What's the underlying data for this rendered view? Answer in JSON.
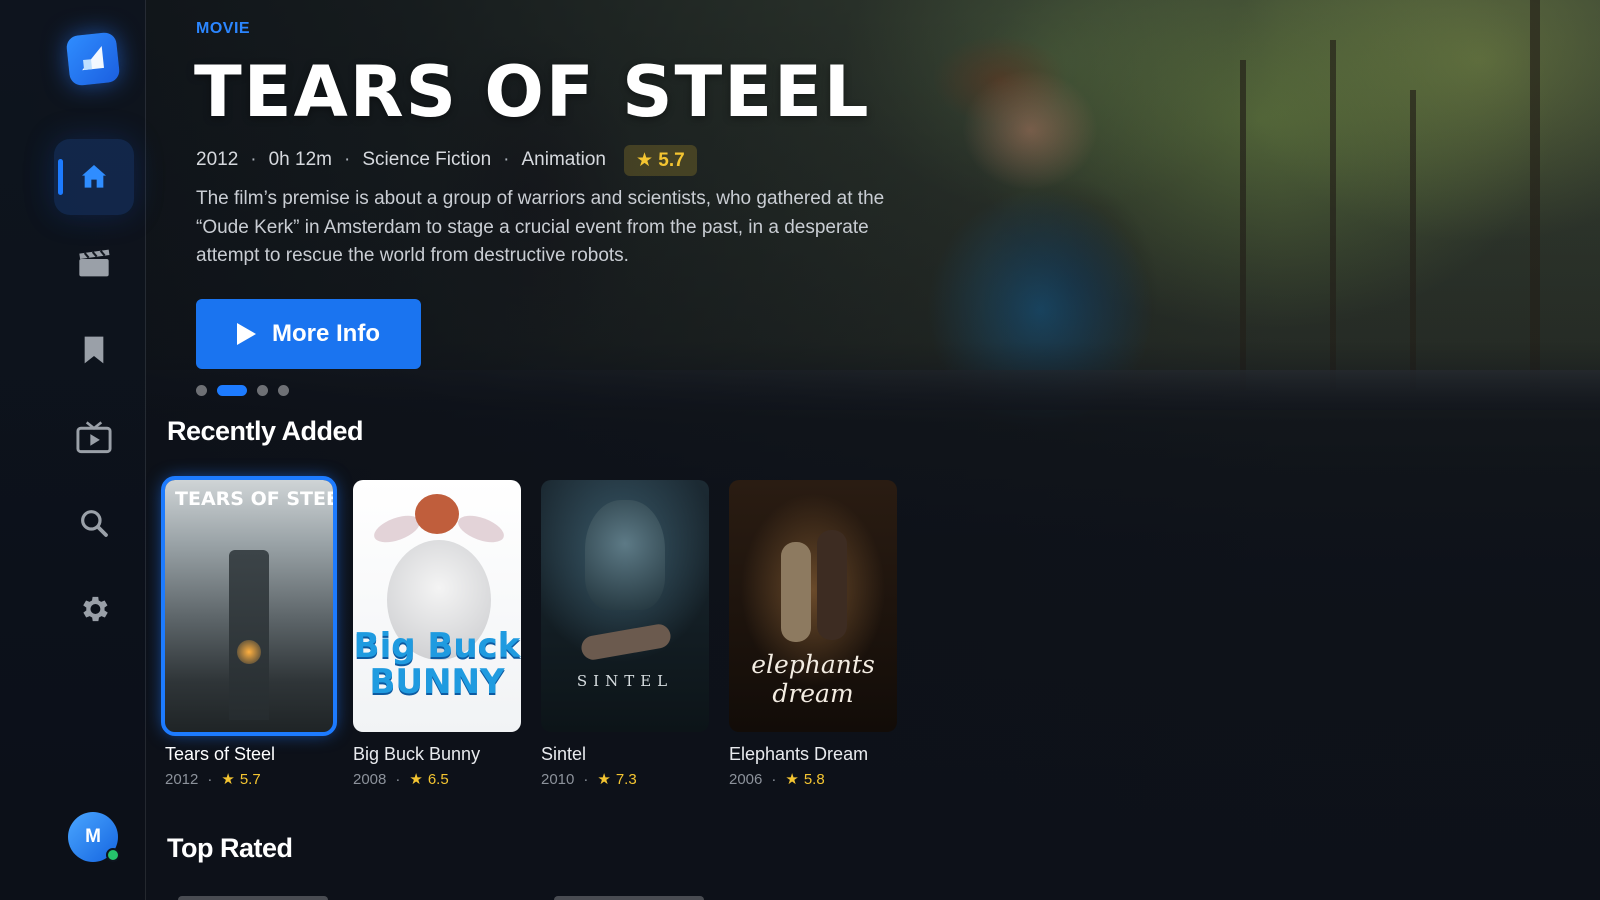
{
  "sidebar": {
    "items": [
      {
        "name": "home",
        "icon": "home-icon",
        "active": true
      },
      {
        "name": "movies",
        "icon": "clapperboard-icon",
        "active": false
      },
      {
        "name": "watchlist",
        "icon": "bookmark-icon",
        "active": false
      },
      {
        "name": "tv",
        "icon": "tv-icon",
        "active": false
      },
      {
        "name": "search",
        "icon": "search-icon",
        "active": false
      },
      {
        "name": "settings",
        "icon": "gear-icon",
        "active": false
      }
    ],
    "avatar_initial": "M"
  },
  "hero": {
    "label": "MOVIE",
    "title": "TEARS OF STEEL",
    "year": "2012",
    "duration": "0h 12m",
    "genres": [
      "Science Fiction",
      "Animation"
    ],
    "separator": "·",
    "rating": "★ 5.7",
    "description": "The film’s premise is about a group of warriors and scientists, who gathered at the “Oude Kerk” in Amsterdam to stage a crucial event from the past, in a desperate attempt to rescue the world from destructive robots.",
    "button_label": "More Info",
    "carousel_pages": 4,
    "carousel_active": 2
  },
  "sections": {
    "recently_added": {
      "title": "Recently Added",
      "items": [
        {
          "title": "Tears of Steel",
          "poster_text": "TEARS OF STEEL",
          "year": "2012",
          "rating": "5.7",
          "focused": true
        },
        {
          "title": "Big Buck Bunny",
          "poster_text": "Big Buck BUNNY",
          "year": "2008",
          "rating": "6.5",
          "focused": false
        },
        {
          "title": "Sintel",
          "poster_text": "SINTEL",
          "year": "2010",
          "rating": "7.3",
          "focused": false
        },
        {
          "title": "Elephants Dream",
          "poster_text": "elephants dream",
          "year": "2006",
          "rating": "5.8",
          "focused": false
        }
      ]
    },
    "top_rated": {
      "title": "Top Rated"
    }
  },
  "colors": {
    "accent": "#1d7bff",
    "rating": "#f4c531",
    "background": "#0d1119",
    "online": "#26c36b"
  }
}
